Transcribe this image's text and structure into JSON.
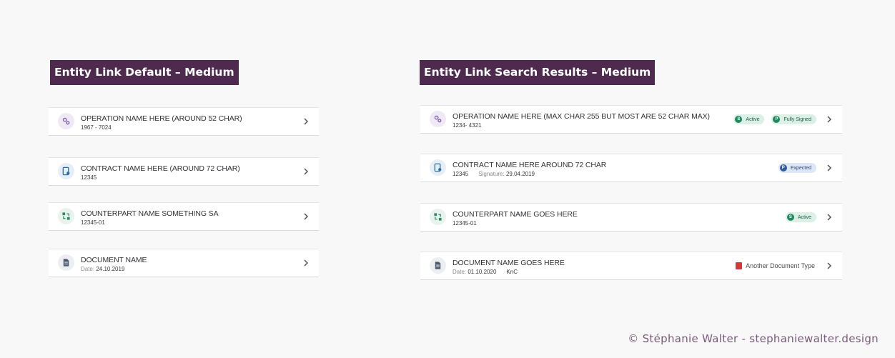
{
  "left": {
    "title": "Entity Link Default – Medium",
    "items": [
      {
        "icon": "gears-icon",
        "title": "OPERATION NAME HERE (AROUND 52 CHAR)",
        "sub_value": "1967 - 7024"
      },
      {
        "icon": "contract-icon",
        "title": "CONTRACT NAME HERE (AROUND 72 CHAR)",
        "sub_value": "12345"
      },
      {
        "icon": "counterpart-icon",
        "title": "COUNTERPART NAME SOMETHING SA",
        "sub_value": "12345-01"
      },
      {
        "icon": "document-icon",
        "title": "DOCUMENT NAME",
        "sub_label": "Date:",
        "sub_value": "24.10.2019"
      }
    ]
  },
  "right": {
    "title": "Entity Link Search Results  – Medium",
    "items": [
      {
        "icon": "gears-icon",
        "title": "OPERATION NAME HERE (MAX CHAR 255 BUT MOST ARE 52 CHAR MAX)",
        "sub_value": "1234- 4321",
        "badges": [
          {
            "letter": "S",
            "label": "Active"
          },
          {
            "letter": "P",
            "label": "Fully Signed"
          }
        ]
      },
      {
        "icon": "contract-icon",
        "title": "CONTRACT NAME HERE AROUND 72 CHAR",
        "sub_value": "12345",
        "sub_label2": "Signature:",
        "sub_value2": "29.04.2019",
        "badges": [
          {
            "letter": "P",
            "label": "Expected"
          }
        ]
      },
      {
        "icon": "counterpart-icon",
        "title": "COUNTERPART NAME GOES HERE",
        "sub_value": "12345-01",
        "badges": [
          {
            "letter": "S",
            "label": "Active"
          }
        ]
      },
      {
        "icon": "document-icon",
        "title": "DOCUMENT NAME GOES HERE",
        "sub_label": "Date:",
        "sub_value": "01.10.2020",
        "sub_value2": "KnC",
        "doc_type": "Another Document Type"
      }
    ]
  },
  "colors": {
    "title_bg": "#4f2a4f",
    "active_green": "#1f8a5e",
    "signed_blue": "#355c9a",
    "pdf_red": "#d13a3a"
  },
  "footer": {
    "credit": "© Stéphanie Walter - stephaniewalter.design"
  }
}
